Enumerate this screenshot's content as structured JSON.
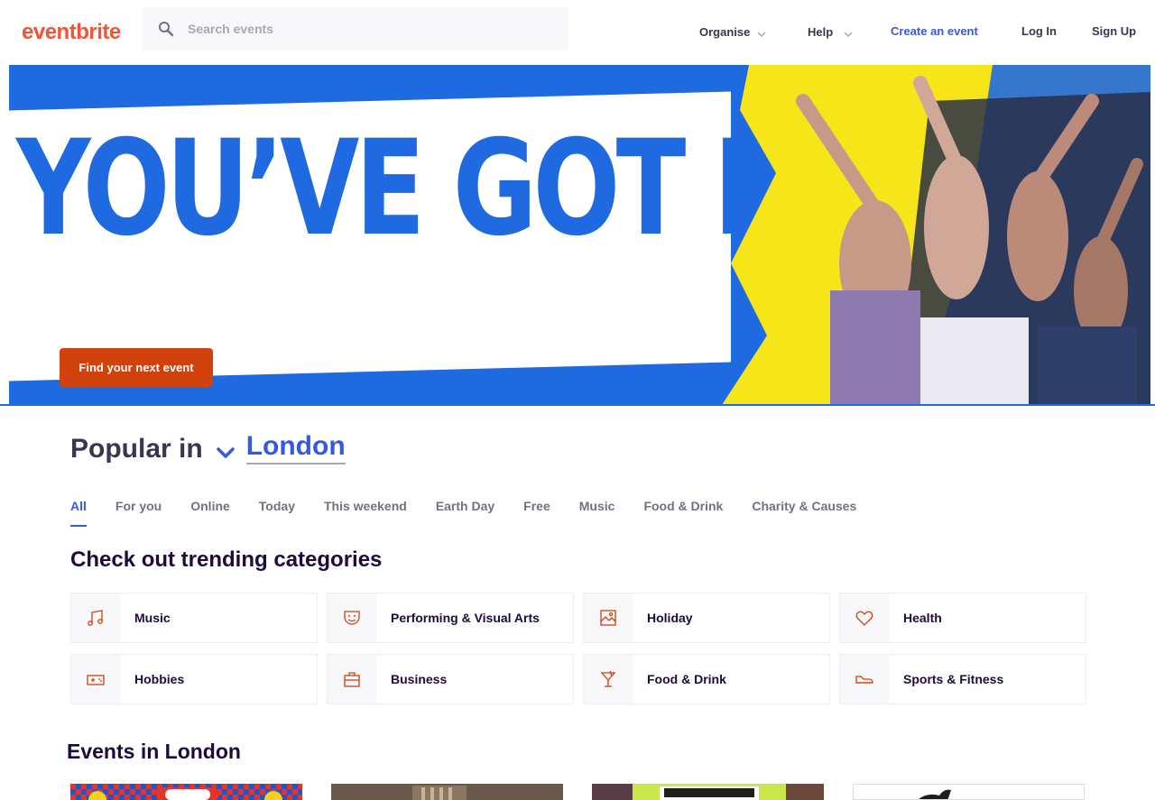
{
  "header": {
    "logo": "eventbrite",
    "search_placeholder": "Search events",
    "nav": {
      "organise": "Organise",
      "help": "Help",
      "create": "Create an event",
      "login": "Log In",
      "signup": "Sign Up"
    }
  },
  "hero": {
    "headline": "YOU’VE GOT PLANS",
    "button": "Find your next event"
  },
  "popular": {
    "label": "Popular in",
    "city": "London"
  },
  "tabs": [
    "All",
    "For you",
    "Online",
    "Today",
    "This weekend",
    "Earth Day",
    "Free",
    "Music",
    "Food & Drink",
    "Charity & Causes"
  ],
  "trending": {
    "title": "Check out trending categories",
    "categories": [
      {
        "label": "Music",
        "icon": "music-note-icon"
      },
      {
        "label": "Performing & Visual Arts",
        "icon": "theater-mask-icon"
      },
      {
        "label": "Holiday",
        "icon": "photo-frame-icon"
      },
      {
        "label": "Health",
        "icon": "heart-icon"
      },
      {
        "label": "Hobbies",
        "icon": "game-controller-icon"
      },
      {
        "label": "Business",
        "icon": "briefcase-icon"
      },
      {
        "label": "Food & Drink",
        "icon": "cocktail-glass-icon"
      },
      {
        "label": "Sports & Fitness",
        "icon": "sneaker-icon"
      }
    ]
  },
  "events": {
    "title": "Events in London"
  },
  "colors": {
    "brand": "#f05537",
    "accent": "#3659e3",
    "hero_blue": "#1f6ae0",
    "hero_yellow": "#f6e619",
    "cta": "#d1410c"
  }
}
